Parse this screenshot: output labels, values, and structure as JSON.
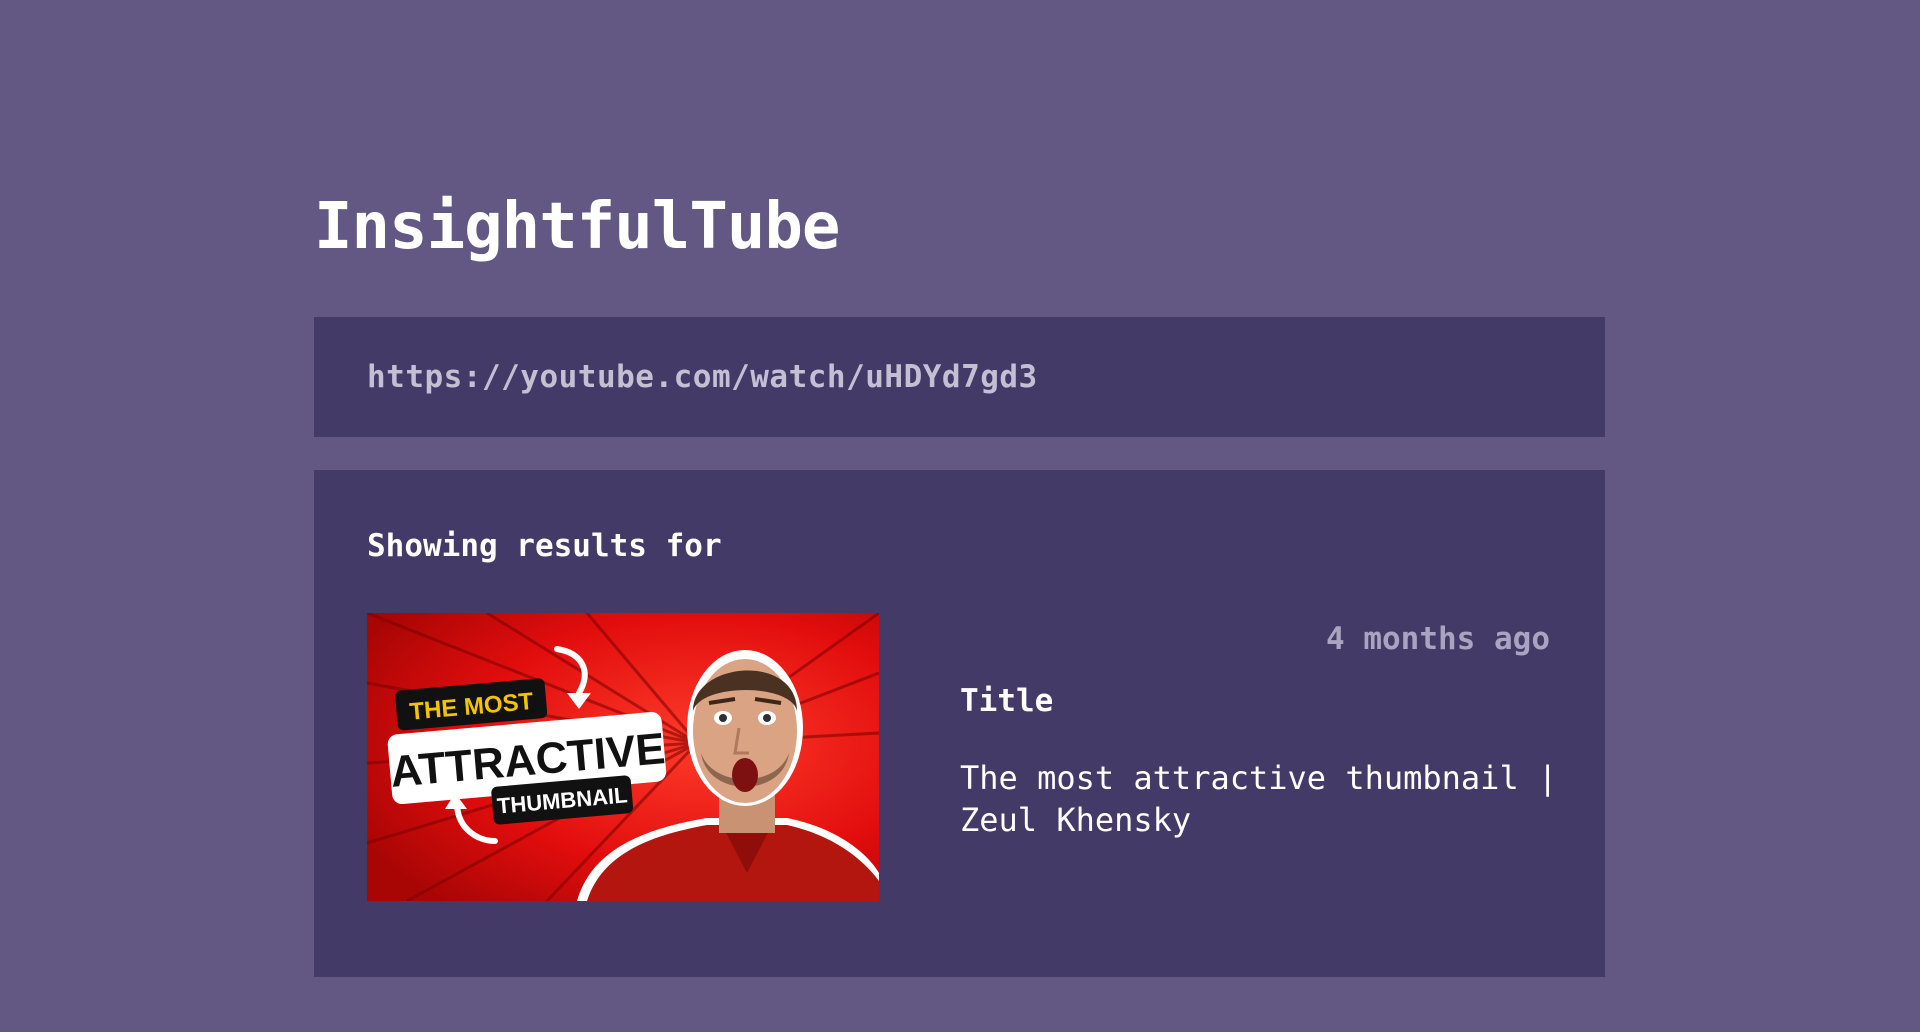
{
  "app": {
    "title": "InsightfulTube"
  },
  "search": {
    "url": "https://youtube.com/watch/uHDYd7gd3"
  },
  "results": {
    "heading": "Showing results for",
    "video": {
      "thumbnail": {
        "line1": "THE MOST",
        "line2": "ATTRACTIVE",
        "line3": "THUMBNAIL"
      },
      "date": "4 months ago",
      "title_label": "Title",
      "title": "The most attractive thumbnail | Zeul Khensky"
    }
  },
  "colors": {
    "background": "#625883",
    "panel": "#433a67",
    "muted_text": "#a9a4bf",
    "thumbnail_red": "#e10d0d"
  }
}
